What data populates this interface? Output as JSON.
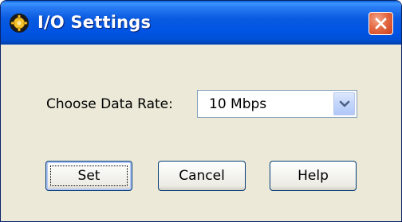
{
  "window": {
    "title": "I/O Settings",
    "title_icon": "gear-gold-icon",
    "close_icon": "close-x-icon",
    "titlebar_color": "#0054e3",
    "close_color": "#e46a44"
  },
  "form": {
    "data_rate_label": "Choose Data Rate:",
    "data_rate_value": "10 Mbps",
    "dropdown_icon": "chevron-down-icon"
  },
  "buttons": {
    "set": "Set",
    "cancel": "Cancel",
    "help": "Help"
  }
}
